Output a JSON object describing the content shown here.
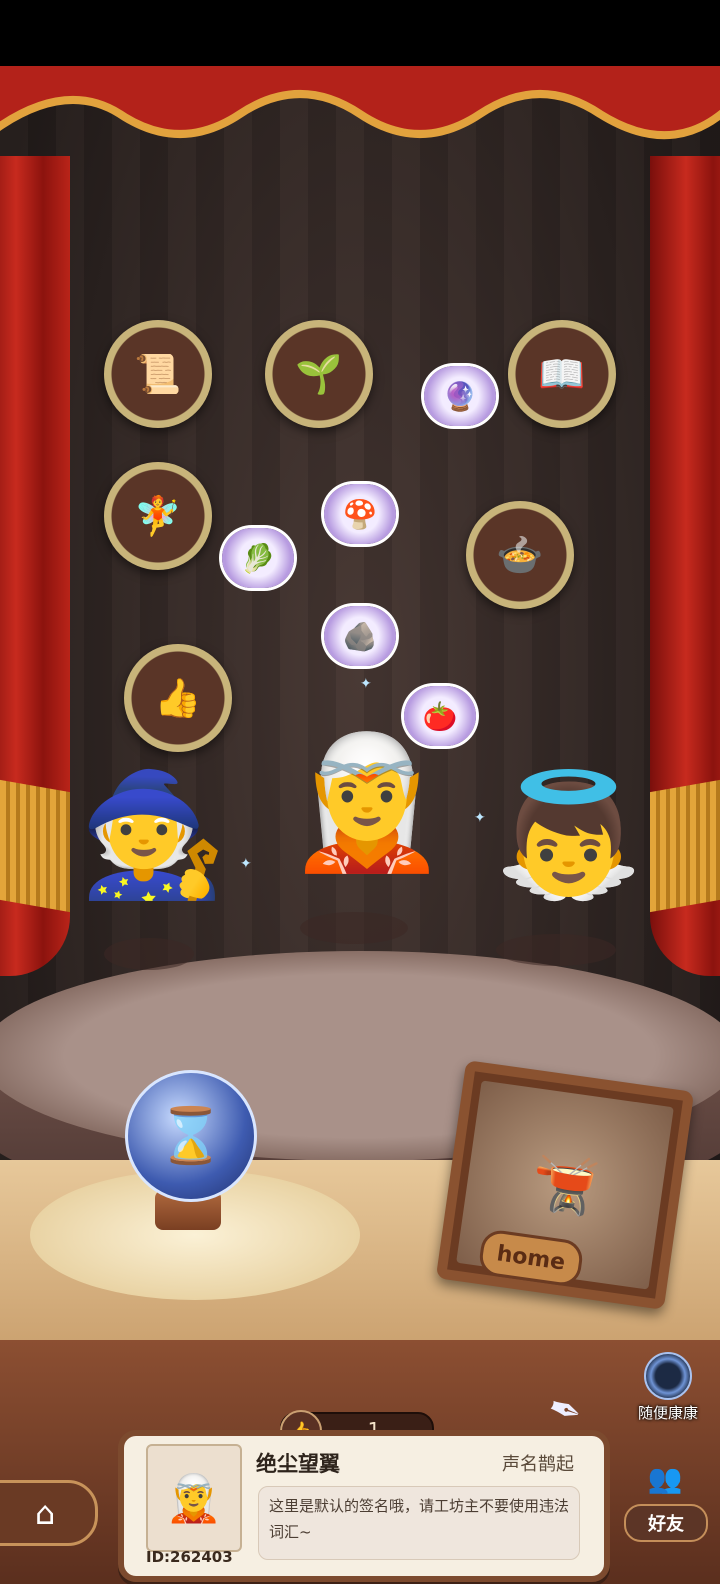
{
  "stage": {
    "medallions": [
      {
        "name": "certificate-medallion",
        "icon": "certificate-icon",
        "glyph": "📜"
      },
      {
        "name": "sprout-medallion",
        "icon": "sprout-icon",
        "glyph": "🌱"
      },
      {
        "name": "book-medallion",
        "icon": "book-icon",
        "glyph": "📖"
      },
      {
        "name": "fairy-medallion",
        "icon": "fairy-icon",
        "glyph": "🧚"
      },
      {
        "name": "cauldron-medallion",
        "icon": "cauldron-icon",
        "glyph": "🍲"
      },
      {
        "name": "thumb-plant-medallion",
        "icon": "thumb-plant-icon",
        "glyph": "👍"
      }
    ],
    "bubbles": [
      {
        "name": "orb-bubble",
        "icon": "gem-orb-icon",
        "glyph": "🔮"
      },
      {
        "name": "mushroom-bubble",
        "icon": "mushroom-icon",
        "glyph": "🍄"
      },
      {
        "name": "leek-bubble",
        "icon": "leek-icon",
        "glyph": "🥬"
      },
      {
        "name": "ore-bubble",
        "icon": "ore-icon",
        "glyph": "🪨"
      },
      {
        "name": "tomato-bubble",
        "icon": "tomato-icon",
        "glyph": "🍅"
      }
    ],
    "characters": [
      {
        "name": "witch-key-character",
        "glyph": "🧙"
      },
      {
        "name": "ice-fairy-character",
        "glyph": "🧝"
      },
      {
        "name": "caged-angel-character",
        "glyph": "👼"
      }
    ]
  },
  "hourglass": {
    "icon": "hourglass-icon",
    "glyph": "⌛"
  },
  "home_frame": {
    "label": "home",
    "glyph": "🫕"
  },
  "random_visit": {
    "label": "随便康康"
  },
  "likes": {
    "icon": "thumbs-up-icon",
    "glyph": "👍",
    "count": "1"
  },
  "profile": {
    "avatar_glyph": "🧝",
    "id": "ID:262403",
    "name": "绝尘望翼",
    "title": "声名鹊起",
    "signature": "这里是默认的签名哦，请工坊主不要使用违法词汇~"
  },
  "nav": {
    "home_glyph": "⌂",
    "friends_label": "好友",
    "friends_glyph": "👥"
  },
  "colors": {
    "curtain": "#c72a1e",
    "wood": "#7c4a2e",
    "card": "#f6efe2"
  }
}
